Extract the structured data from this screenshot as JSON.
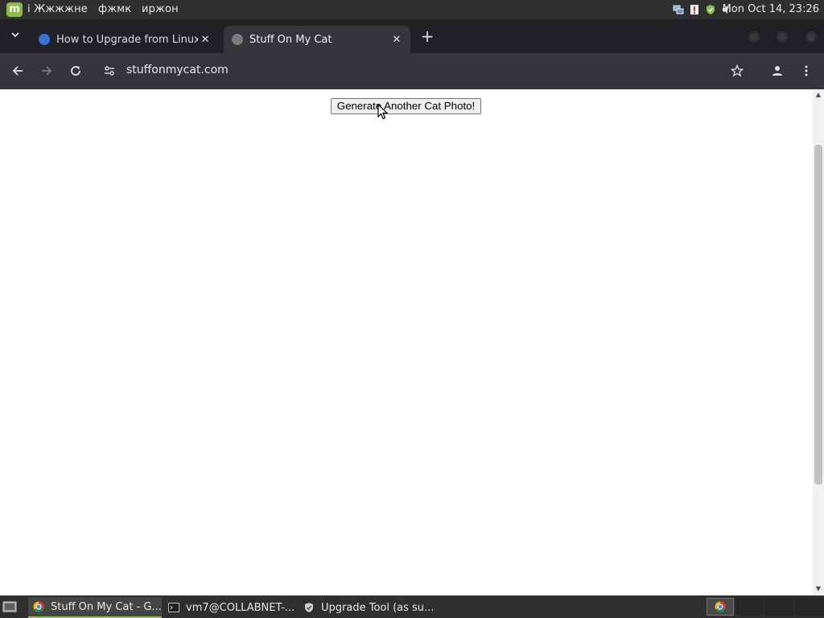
{
  "top_panel": {
    "menu_text_1": "i Жжжжне",
    "menu_text_2": "фжмк",
    "menu_text_3": "иржон",
    "clock": "Mon Oct 14, 23:26"
  },
  "browser": {
    "tabs": [
      {
        "title": "How to Upgrade from Linux",
        "favicon": "shield-favicon-icon"
      },
      {
        "title": "Stuff On My Cat",
        "favicon": "globe-favicon-icon"
      }
    ],
    "url": "stuffonmycat.com"
  },
  "page": {
    "button_label": "Generate Another Cat Photo!"
  },
  "taskbar": {
    "items": [
      {
        "label": "Stuff On My Cat - G...",
        "icon": "chrome-icon"
      },
      {
        "label": "vm7@COLLABNET-...",
        "icon": "terminal-icon"
      },
      {
        "label": "Upgrade Tool (as su...",
        "icon": "shield-icon"
      }
    ]
  },
  "colors": {
    "panel_bg": "#2f2f2f",
    "tabstrip_bg": "#202124",
    "toolbar_bg": "#35363a",
    "mint_accent": "#86be43"
  }
}
